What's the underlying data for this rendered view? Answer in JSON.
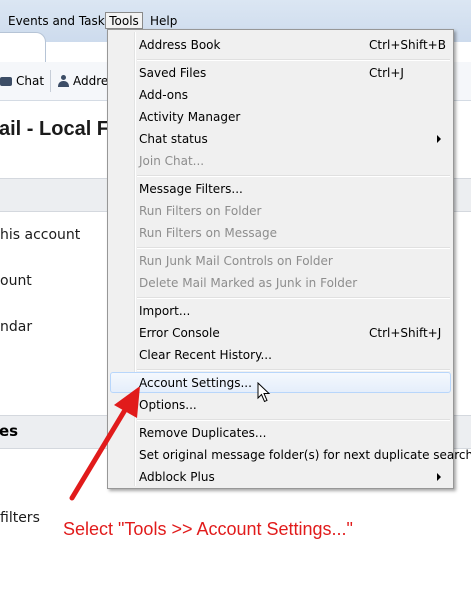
{
  "menubar": {
    "events_tasks": "Events and Tasks",
    "tools": "Tools",
    "help": "Help"
  },
  "toolbar": {
    "chat": "Chat",
    "address_book": "Addre"
  },
  "main": {
    "title": "ail - Local F",
    "links": [
      "his account",
      "ount",
      "ndar"
    ],
    "section_two": "es",
    "filters_link": " filters"
  },
  "tools_menu": {
    "items": [
      {
        "label": "Address Book",
        "shortcut": "Ctrl+Shift+B"
      },
      {
        "label": "Saved Files",
        "shortcut": "Ctrl+J"
      },
      {
        "label": "Add-ons",
        "shortcut": ""
      },
      {
        "label": "Activity Manager",
        "shortcut": ""
      },
      {
        "label": "Chat status",
        "shortcut": ""
      },
      {
        "label": "Join Chat...",
        "shortcut": ""
      },
      {
        "label": "Message Filters...",
        "shortcut": ""
      },
      {
        "label": "Run Filters on Folder",
        "shortcut": ""
      },
      {
        "label": "Run Filters on Message",
        "shortcut": ""
      },
      {
        "label": "Run Junk Mail Controls on Folder",
        "shortcut": ""
      },
      {
        "label": "Delete Mail Marked as Junk in Folder",
        "shortcut": ""
      },
      {
        "label": "Import...",
        "shortcut": ""
      },
      {
        "label": "Error Console",
        "shortcut": "Ctrl+Shift+J"
      },
      {
        "label": "Clear Recent History...",
        "shortcut": ""
      },
      {
        "label": "Account Settings...",
        "shortcut": ""
      },
      {
        "label": "Options...",
        "shortcut": ""
      },
      {
        "label": "Remove Duplicates...",
        "shortcut": ""
      },
      {
        "label": "Set original message folder(s) for next duplicate search",
        "shortcut": ""
      },
      {
        "label": "Adblock Plus",
        "shortcut": ""
      }
    ]
  },
  "annotation": {
    "text": "Select \"Tools >> Account Settings...\"",
    "color": "#e11b1b"
  },
  "icons": [
    "chat-icon",
    "address-book-icon",
    "submenu-arrow-icon",
    "mouse-pointer-icon",
    "annotation-arrow"
  ]
}
